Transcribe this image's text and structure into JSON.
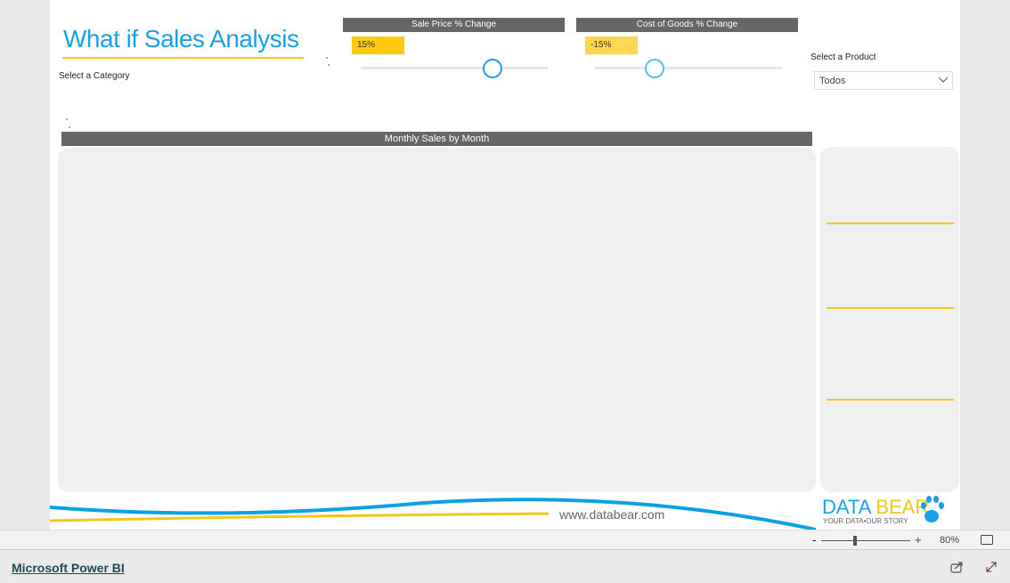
{
  "report": {
    "title": "What if Sales Analysis",
    "category_label": "Select a Category",
    "sale_price": {
      "header": "Sale Price % Change",
      "value": "15%",
      "slider_percent": 70
    },
    "cost_of_goods": {
      "header": "Cost of Goods % Change",
      "value": "-15%",
      "slider_percent": 32
    },
    "product": {
      "label": "Select a Product",
      "selected": "Todos"
    },
    "chart_header": "Monthly Sales by Month",
    "footer": {
      "url": "www.databear.com",
      "brand_a": "DATA",
      "brand_b": "BEAR",
      "tagline": "YOUR DATA•OUR STORY"
    }
  },
  "zoom": {
    "minus": "-",
    "plus": "+",
    "level": "80%"
  },
  "app": {
    "link": "Microsoft Power BI"
  },
  "colors": {
    "accent": "#1aa0e8",
    "yellow": "#f5c518",
    "header": "#666666"
  }
}
